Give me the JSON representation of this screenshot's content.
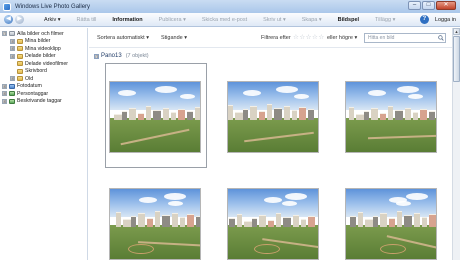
{
  "window": {
    "title": "Windows Live Photo Gallery",
    "controls": {
      "minimize": "–",
      "maximize": "□",
      "close": "✕"
    },
    "accent": "#aac7ea"
  },
  "menubar": {
    "items": [
      {
        "label": "Arkiv ▾",
        "enabled": true
      },
      {
        "label": "Rätta till",
        "enabled": false
      },
      {
        "label": "Information",
        "enabled": true
      },
      {
        "label": "Publicera ▾",
        "enabled": false
      },
      {
        "label": "Skicka med e-post",
        "enabled": false
      },
      {
        "label": "Skriv ut ▾",
        "enabled": false
      },
      {
        "label": "Skapa ▾",
        "enabled": false
      },
      {
        "label": "Bildspel",
        "enabled": true
      },
      {
        "label": "Tillägg ▾",
        "enabled": false
      }
    ],
    "help": "?",
    "login": "Logga in"
  },
  "nav": {
    "items": [
      {
        "label": "Alla bilder och filmer",
        "expander": "⊟",
        "icon": "gray"
      },
      {
        "label": "Mina bilder",
        "expander": "⊞",
        "icon": "yellow"
      },
      {
        "label": "Mina videoklipp",
        "expander": "⊞",
        "icon": "yellow"
      },
      {
        "label": "Delade bilder",
        "expander": "⊞",
        "icon": "yellow"
      },
      {
        "label": "Delade videofilmer",
        "expander": "",
        "icon": "yellow"
      },
      {
        "label": "Skrivbord",
        "expander": "",
        "icon": "yellow"
      },
      {
        "label": "Old",
        "expander": "⊞",
        "icon": "yellow"
      },
      {
        "label": "Fotodatum",
        "expander": "⊞",
        "icon": "blue"
      },
      {
        "label": "Persontaggar",
        "expander": "⊞",
        "icon": "green"
      },
      {
        "label": "Beskrivande taggar",
        "expander": "⊞",
        "icon": "green"
      }
    ]
  },
  "toolbar": {
    "sort_label": "Sortera automatiskt ▾",
    "sort_order": "Stigande ▾",
    "filter_label": "Filtrera efter",
    "filter_higher": "eller högre ▾",
    "stars": [
      "☆",
      "☆",
      "☆",
      "☆",
      "☆"
    ],
    "search_placeholder": "Hitta en bild"
  },
  "group": {
    "toggle": "⊟",
    "name": "Pano13",
    "count": "(7 objekt)"
  },
  "scrollbar": {
    "up": "▲"
  },
  "thumbnails": [
    {
      "name": "photo-1",
      "variant": 0,
      "selected": true
    },
    {
      "name": "photo-2",
      "variant": 1,
      "selected": false
    },
    {
      "name": "photo-3",
      "variant": 2,
      "selected": false
    },
    {
      "name": "photo-4",
      "variant": 3,
      "selected": false
    },
    {
      "name": "photo-5",
      "variant": 4,
      "selected": false
    },
    {
      "name": "photo-6",
      "variant": 5,
      "selected": false
    }
  ]
}
